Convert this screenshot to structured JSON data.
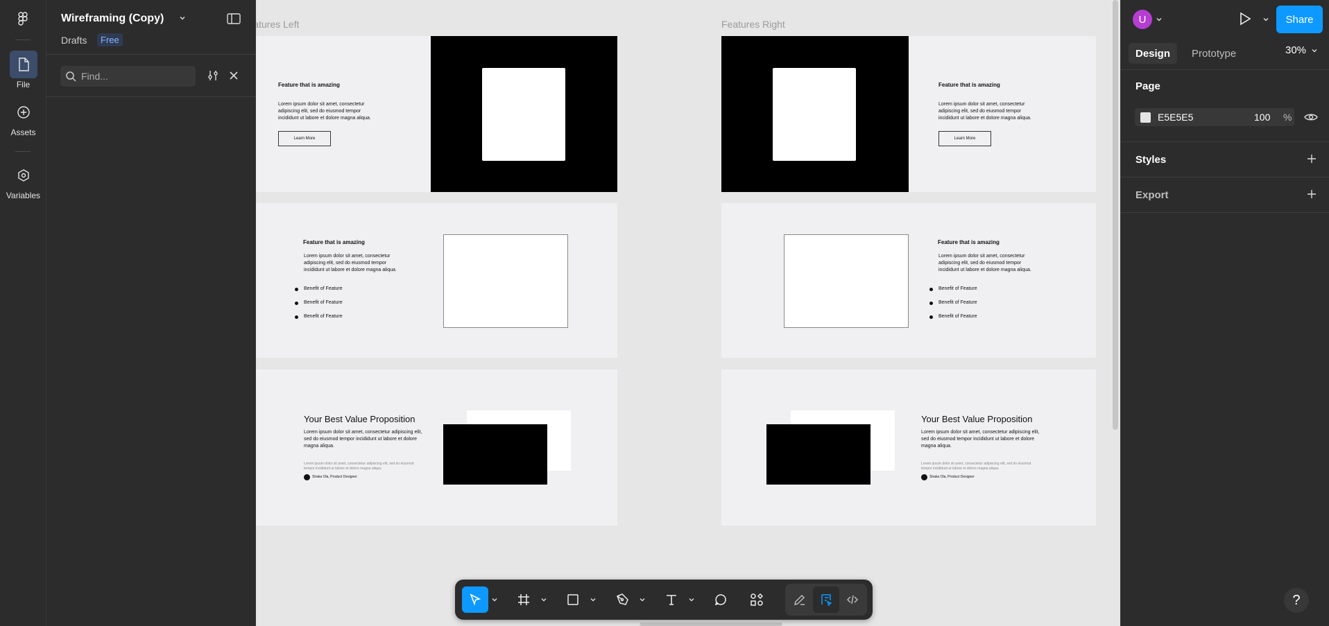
{
  "rail": {
    "items": [
      {
        "label": "File"
      },
      {
        "label": "Assets"
      },
      {
        "label": "Variables"
      }
    ]
  },
  "left_panel": {
    "title": "Wireframing (Copy)",
    "drafts": "Drafts",
    "plan_badge": "Free",
    "search_placeholder": "Find..."
  },
  "canvas": {
    "frame_left_label": "Features Left",
    "frame_right_label": "Features Right",
    "feature_heading": "Feature that is amazing",
    "lorem_1": "Lorem ipsum dolor sit amet, consectetur",
    "lorem_2": "adipiscing elit, sed do eiusmod tempor",
    "lorem_3": "incididunt ut labore et dolore magna aliqua.",
    "learn_more": "Learn More",
    "benefit": "Benefit of Feature",
    "value_prop": "Your Best Value Proposition",
    "vp_1": "Lorem ipsum dolor sit amet, consectetur adipiscing elit,",
    "vp_2": "sed do eiusmod tempor incididunt ut labore et dolore",
    "vp_3": "magna aliqua.",
    "quote_1": "Lorem ipsum dolor sit amet, consectetur adipiscing elit, sed do eiusmod",
    "quote_2": "tempor incididunt ut labore et dolore magna aliqua.",
    "author": "Shaka Ola, Product Designer"
  },
  "right_panel": {
    "avatar_initial": "U",
    "share_label": "Share",
    "tab_design": "Design",
    "tab_prototype": "Prototype",
    "zoom": "30%",
    "page_heading": "Page",
    "page_fill_hex": "E5E5E5",
    "page_fill_opacity": "100",
    "percent_sign": "%",
    "styles_heading": "Styles",
    "export_heading": "Export",
    "help": "?"
  },
  "colors": {
    "accent": "#0d99ff",
    "panel_bg": "#2c2c2c",
    "canvas_bg": "#e6e6e6",
    "avatar": "#b53dd1"
  }
}
